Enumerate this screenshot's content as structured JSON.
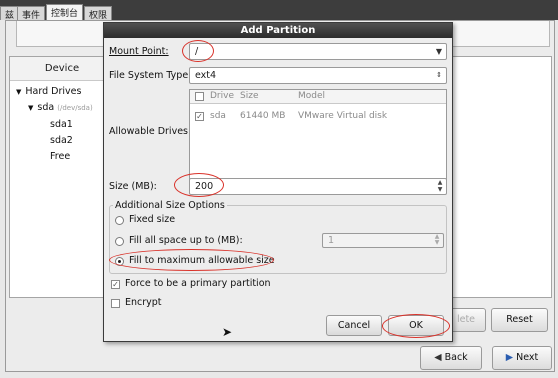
{
  "tabs": [
    "兹",
    "事件",
    "控制台",
    "权限"
  ],
  "background": {
    "device_header": "Device",
    "tree": {
      "root": "Hard Drives",
      "disk": "sda",
      "disk_path": "(/dev/sda)",
      "partitions": [
        "sda1",
        "sda2",
        "Free"
      ]
    },
    "buttons": {
      "delete": "lete",
      "reset": "Reset",
      "back": "Back",
      "next": "Next"
    }
  },
  "dialog": {
    "title": "Add Partition",
    "mount_point_label": "Mount Point:",
    "mount_point_value": "/",
    "fs_type_label": "File System Type:",
    "fs_type_value": "ext4",
    "allowable_drives_label": "Allowable Drives:",
    "drives_columns": [
      "Drive",
      "Size",
      "Model"
    ],
    "drives_rows": [
      {
        "checked": true,
        "drive": "sda",
        "size": "61440 MB",
        "model": "VMware Virtual disk"
      }
    ],
    "size_label": "Size (MB):",
    "size_value": "200",
    "size_options_title": "Additional Size Options",
    "options": {
      "fixed": "Fixed size",
      "fill_up_to": "Fill all space up to (MB):",
      "fill_max": "Fill to maximum allowable size",
      "selected": "fill_max"
    },
    "fill_up_to_value": "1",
    "primary_label": "Force to be a primary partition",
    "primary_checked": true,
    "encrypt_label": "Encrypt",
    "encrypt_checked": false,
    "cancel": "Cancel",
    "ok": "OK"
  },
  "colors": {
    "annotation": "#d9322a",
    "titlebar": "#3a3a3a"
  }
}
